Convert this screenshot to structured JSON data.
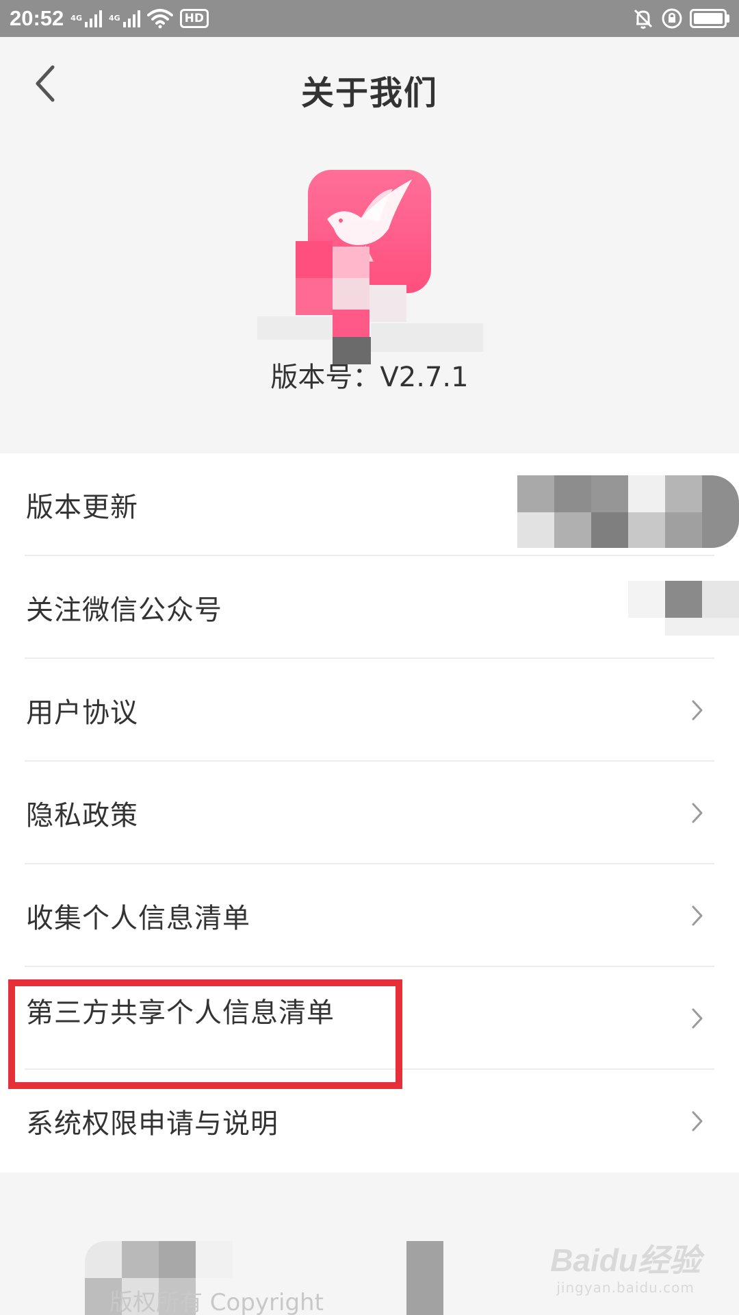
{
  "status_bar": {
    "time": "20:52",
    "network_1": "4G",
    "network_2": "4G",
    "hd_label": "HD"
  },
  "header": {
    "title": "关于我们"
  },
  "app_info": {
    "version_label": "版本号：V2.7.1"
  },
  "menu": {
    "items": [
      {
        "label": "版本更新",
        "has_chevron": false
      },
      {
        "label": "关注微信公众号",
        "has_chevron": false
      },
      {
        "label": "用户协议",
        "has_chevron": true
      },
      {
        "label": "隐私政策",
        "has_chevron": true
      },
      {
        "label": "收集个人信息清单",
        "has_chevron": true
      },
      {
        "label": "第三方共享个人信息清单",
        "has_chevron": true,
        "highlighted": true
      },
      {
        "label": "系统权限申请与说明",
        "has_chevron": true
      }
    ]
  },
  "footer": {
    "copyright_text": "版权所有 Copyright",
    "watermark_main": "Baidu经验",
    "watermark_sub": "jingyan.baidu.com"
  },
  "colors": {
    "brand_pink": "#ff5a87",
    "highlight_red": "#e5303a",
    "status_bar_gray": "#8f8f8f"
  },
  "icons": {
    "back": "chevron-left-icon",
    "row_arrow": "chevron-right-icon",
    "logo": "bird-logo-icon"
  }
}
